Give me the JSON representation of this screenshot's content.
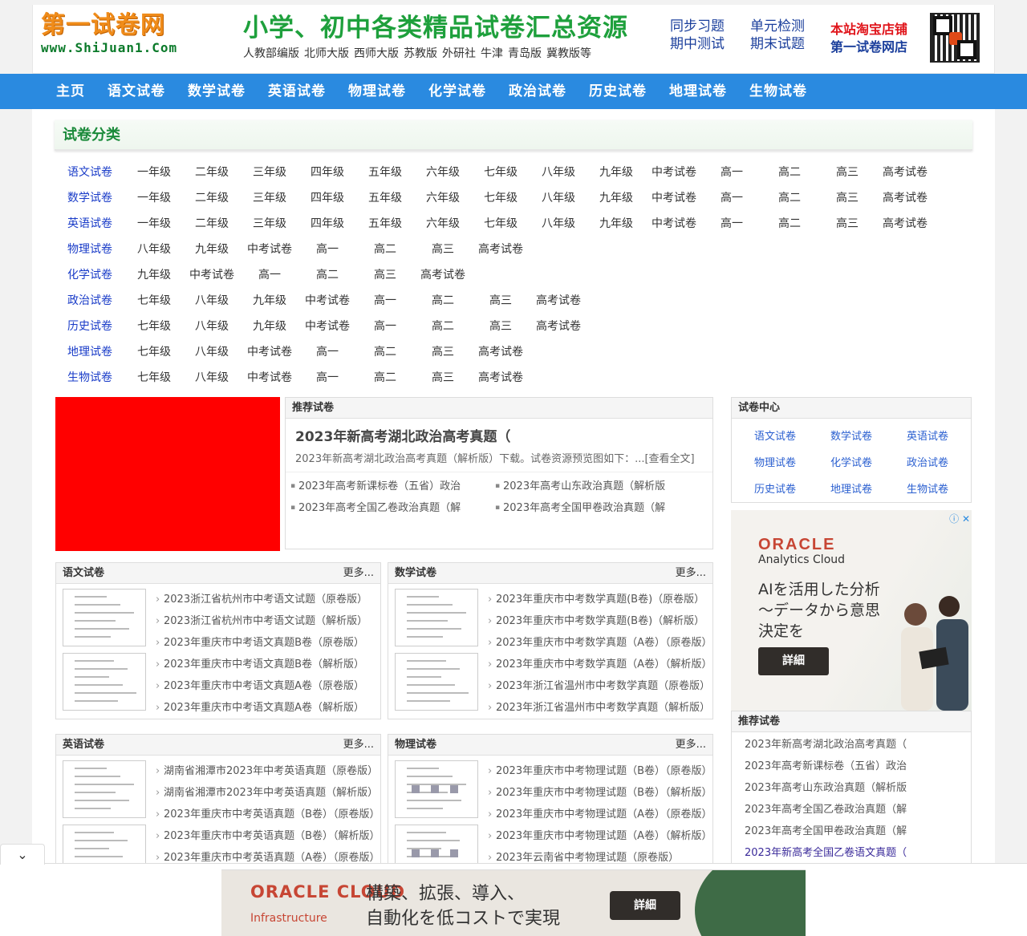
{
  "header": {
    "logo_cn": "第一试卷网",
    "logo_en": "www.ShiJuan1.Com",
    "slogan": "小学、初中各类精品试卷汇总资源",
    "publishers": [
      "人教部编版",
      "北师大版",
      "西师大版",
      "苏教版",
      "外研社",
      "牛津",
      "青岛版",
      "冀教版等"
    ],
    "quick_links": [
      "同步习题",
      "单元检测",
      "期中测试",
      "期末试题"
    ],
    "taobao_1": "本站淘宝店铺",
    "taobao_2": "第一试卷网店"
  },
  "nav": [
    "主页",
    "语文试卷",
    "数学试卷",
    "英语试卷",
    "物理试卷",
    "化学试卷",
    "政治试卷",
    "历史试卷",
    "地理试卷",
    "生物试卷"
  ],
  "categories": {
    "title": "试卷分类",
    "rows": [
      {
        "subject": "语文试卷",
        "items": [
          "一年级",
          "二年级",
          "三年级",
          "四年级",
          "五年级",
          "六年级",
          "七年级",
          "八年级",
          "九年级",
          "中考试卷",
          "高一",
          "高二",
          "高三",
          "高考试卷"
        ]
      },
      {
        "subject": "数学试卷",
        "items": [
          "一年级",
          "二年级",
          "三年级",
          "四年级",
          "五年级",
          "六年级",
          "七年级",
          "八年级",
          "九年级",
          "中考试卷",
          "高一",
          "高二",
          "高三",
          "高考试卷"
        ]
      },
      {
        "subject": "英语试卷",
        "items": [
          "一年级",
          "二年级",
          "三年级",
          "四年级",
          "五年级",
          "六年级",
          "七年级",
          "八年级",
          "九年级",
          "中考试卷",
          "高一",
          "高二",
          "高三",
          "高考试卷"
        ]
      },
      {
        "subject": "物理试卷",
        "items": [
          "八年级",
          "九年级",
          "中考试卷",
          "高一",
          "高二",
          "高三",
          "高考试卷"
        ]
      },
      {
        "subject": "化学试卷",
        "items": [
          "九年级",
          "中考试卷",
          "高一",
          "高二",
          "高三",
          "高考试卷"
        ]
      },
      {
        "subject": "政治试卷",
        "items": [
          "七年级",
          "八年级",
          "九年级",
          "中考试卷",
          "高一",
          "高二",
          "高三",
          "高考试卷"
        ]
      },
      {
        "subject": "历史试卷",
        "items": [
          "七年级",
          "八年级",
          "九年级",
          "中考试卷",
          "高一",
          "高二",
          "高三",
          "高考试卷"
        ]
      },
      {
        "subject": "地理试卷",
        "items": [
          "七年级",
          "八年级",
          "中考试卷",
          "高一",
          "高二",
          "高三",
          "高考试卷"
        ]
      },
      {
        "subject": "生物试卷",
        "items": [
          "七年级",
          "八年级",
          "中考试卷",
          "高一",
          "高二",
          "高三",
          "高考试卷"
        ]
      }
    ]
  },
  "recommend": {
    "header": "推荐试卷",
    "title": "2023年新高考湖北政治高考真题（",
    "desc": "2023年新高考湖北政治高考真题（解析版）下载。试卷资源预览图如下：...[查看全文]",
    "items": [
      "2023年高考新课标卷（五省）政治",
      "2023年高考山东政治真题（解析版",
      "2023年高考全国乙卷政治真题（解",
      "2023年高考全国甲卷政治真题（解"
    ]
  },
  "center": {
    "header": "试卷中心",
    "items": [
      "语文试卷",
      "数学试卷",
      "英语试卷",
      "物理试卷",
      "化学试卷",
      "政治试卷",
      "历史试卷",
      "地理试卷",
      "生物试卷"
    ]
  },
  "ad_side": {
    "brand": "ORACLE",
    "sub": "Analytics Cloud",
    "copy": "AIを活用した分析～データから意思決定を",
    "button": "詳細"
  },
  "side_recommend": {
    "header": "推荐试卷",
    "items": [
      "2023年新高考湖北政治高考真题（",
      "2023年高考新课标卷（五省）政治",
      "2023年高考山东政治真题（解析版",
      "2023年高考全国乙卷政治真题（解",
      "2023年高考全国甲卷政治真题（解",
      "2023年新高考全国乙卷语文真题（"
    ]
  },
  "boxes": [
    {
      "title": "语文试卷",
      "more": "更多...",
      "items": [
        "2023浙江省杭州市中考语文试题（原卷版）",
        "2023浙江省杭州市中考语文试题（解析版）",
        "2023年重庆市中考语文真题B卷（原卷版）",
        "2023年重庆市中考语文真题B卷（解析版）",
        "2023年重庆市中考语文真题A卷（原卷版）",
        "2023年重庆市中考语文真题A卷（解析版）"
      ]
    },
    {
      "title": "数学试卷",
      "more": "更多...",
      "items": [
        "2023年重庆市中考数学真题(B卷)（原卷版）",
        "2023年重庆市中考数学真题(B卷)（解析版）",
        "2023年重庆市中考数学真题（A卷）（原卷版）",
        "2023年重庆市中考数学真题（A卷）（解析版）",
        "2023年浙江省温州市中考数学真题（原卷版）",
        "2023年浙江省温州市中考数学真题（解析版）"
      ]
    },
    {
      "title": "英语试卷",
      "more": "更多...",
      "items": [
        "湖南省湘潭市2023年中考英语真题（原卷版）",
        "湖南省湘潭市2023年中考英语真题（解析版）",
        "2023年重庆市中考英语真题（B卷）（原卷版）",
        "2023年重庆市中考英语真题（B卷）（解析版）",
        "2023年重庆市中考英语真题（A卷）（原卷版）"
      ]
    },
    {
      "title": "物理试卷",
      "more": "更多...",
      "items": [
        "2023年重庆市中考物理试题（B卷）（原卷版）",
        "2023年重庆市中考物理试题（B卷）（解析版）",
        "2023年重庆市中考物理试题（A卷）（原卷版）",
        "2023年重庆市中考物理试题（A卷）（解析版）",
        "2023年云南省中考物理试题（原卷版）"
      ]
    }
  ],
  "ad_bottom": {
    "brand": "ORACLE CLOUD",
    "sub": "Infrastructure",
    "copy_1": "構築、拡張、導入、",
    "copy_2": "自動化を低コストで実現",
    "button": "詳細"
  },
  "colors": {
    "nav": "#2a8ae0",
    "accent_green": "#1ea03c",
    "link_blue": "#1a3cc8",
    "red_block": "#ff0000",
    "oracle_red": "#c74634"
  }
}
